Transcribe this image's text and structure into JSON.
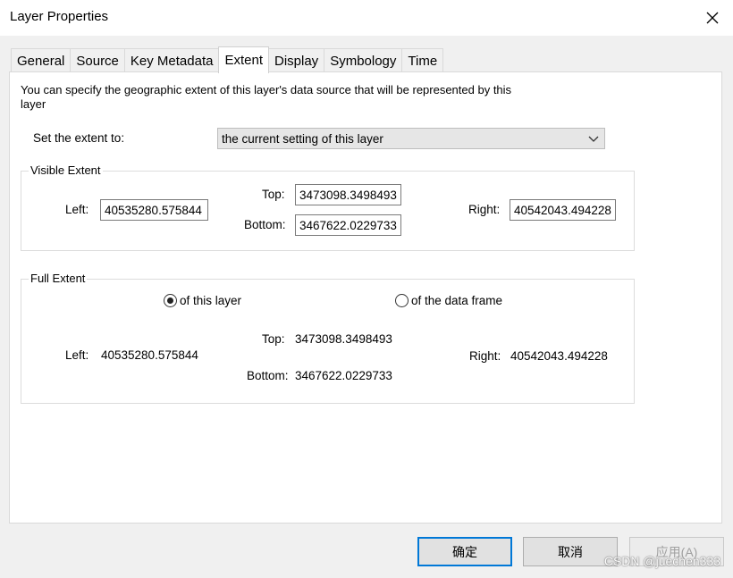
{
  "window": {
    "title": "Layer Properties"
  },
  "tabs": [
    {
      "label": "General"
    },
    {
      "label": "Source"
    },
    {
      "label": "Key Metadata"
    },
    {
      "label": "Extent"
    },
    {
      "label": "Display"
    },
    {
      "label": "Symbology"
    },
    {
      "label": "Time"
    }
  ],
  "active_tab": "Extent",
  "description": "You can specify the geographic extent of this layer's data source that will be represented by this layer",
  "set_extent": {
    "label": "Set the extent to:",
    "value": "the current setting of this layer"
  },
  "visible_extent": {
    "legend": "Visible Extent",
    "left_label": "Left:",
    "left_value": "40535280.575844",
    "top_label": "Top:",
    "top_value": "3473098.3498493",
    "bottom_label": "Bottom:",
    "bottom_value": "3467622.0229733",
    "right_label": "Right:",
    "right_value": "40542043.494228"
  },
  "full_extent": {
    "legend": "Full Extent",
    "radio_layer": "of this layer",
    "radio_frame": "of the data frame",
    "selected": "of this layer",
    "left_label": "Left:",
    "left_value": "40535280.575844",
    "top_label": "Top:",
    "top_value": "3473098.3498493",
    "bottom_label": "Bottom:",
    "bottom_value": "3467622.0229733",
    "right_label": "Right:",
    "right_value": "40542043.494228"
  },
  "buttons": {
    "ok": "确定",
    "cancel": "取消",
    "apply": "应用(A)"
  },
  "watermark": "CSDN @juechen333",
  "colors": {
    "accent": "#0078d7",
    "panel": "#ffffff",
    "window": "#f0f0f0"
  }
}
